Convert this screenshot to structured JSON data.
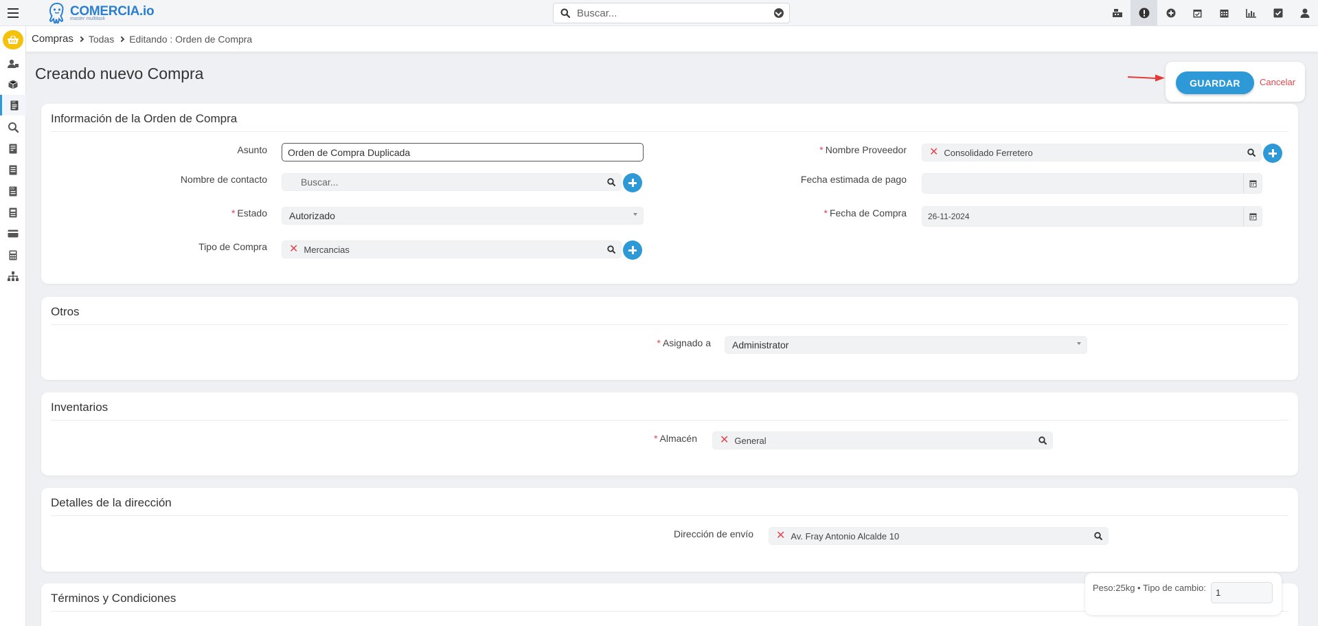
{
  "app": {
    "brand": "COMERCIA.io",
    "tagline": "master multitask"
  },
  "topbar": {
    "search_placeholder": "Buscar...",
    "icons": [
      "cash-register-icon",
      "alert-icon",
      "plus-circle-icon",
      "calendar-check-icon",
      "calendar-icon",
      "chart-icon",
      "checkbox-icon",
      "user-icon"
    ]
  },
  "breadcrumb": [
    "Compras",
    "Todas",
    "Editando : Orden de Compra"
  ],
  "page": {
    "title": "Creando nuevo Compra",
    "save_label": "GUARDAR",
    "cancel_label": "Cancelar"
  },
  "sections": {
    "info": {
      "title": "Información de la Orden de Compra",
      "asunto_label": "Asunto",
      "asunto_value": "Orden de Compra Duplicada",
      "contacto_label": "Nombre de contacto",
      "contacto_placeholder": "Buscar...",
      "estado_label": "Estado",
      "estado_value": "Autorizado",
      "tipo_label": "Tipo de Compra",
      "tipo_value": "Mercancias",
      "proveedor_label": "Nombre Proveedor",
      "proveedor_value": "Consolidado Ferretero",
      "fecha_pago_label": "Fecha estimada de pago",
      "fecha_pago_value": "",
      "fecha_compra_label": "Fecha de Compra",
      "fecha_compra_value": "26-11-2024"
    },
    "otros": {
      "title": "Otros",
      "asignado_label": "Asignado a",
      "asignado_value": "Administrator"
    },
    "inventarios": {
      "title": "Inventarios",
      "almacen_label": "Almacén",
      "almacen_value": "General"
    },
    "direccion": {
      "title": "Detalles de la dirección",
      "envio_label": "Dirección de envío",
      "envio_value": "Av. Fray Antonio Alcalde 10"
    },
    "terminos": {
      "title": "Términos y Condiciones"
    }
  },
  "footer": {
    "summary": "Peso:25kg • Tipo de cambio:",
    "exchange_value": "1"
  },
  "colors": {
    "primary": "#2d9ad7",
    "danger": "#e0474c",
    "home": "#f4c20d"
  }
}
